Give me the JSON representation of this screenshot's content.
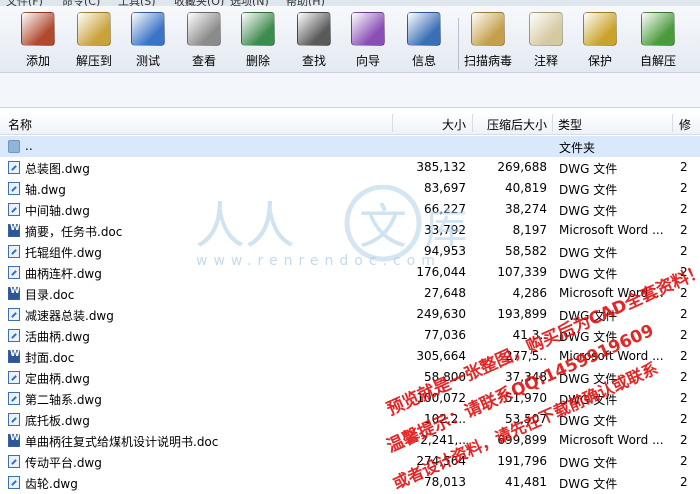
{
  "menu": [
    "文件(F)",
    "命令(C)",
    "工具(S)",
    "收藏夹(O)",
    "选项(N)",
    "帮助(H)"
  ],
  "toolbar": [
    {
      "label": "添加",
      "icon": "add-archive-icon",
      "color": "#b04a2e"
    },
    {
      "label": "解压到",
      "icon": "extract-to-icon",
      "color": "#c9a23a"
    },
    {
      "label": "测试",
      "icon": "test-icon",
      "color": "#3b74c7"
    },
    {
      "label": "查看",
      "icon": "view-icon",
      "color": "#8b8b8b"
    },
    {
      "label": "删除",
      "icon": "delete-icon",
      "color": "#3f8b4f"
    },
    {
      "label": "查找",
      "icon": "find-icon",
      "color": "#5a5a5a"
    },
    {
      "label": "向导",
      "icon": "wizard-icon",
      "color": "#8a4fb5"
    },
    {
      "label": "信息",
      "icon": "info-icon",
      "color": "#3a6fb5"
    },
    {
      "label": "扫描病毒",
      "icon": "scan-virus-icon",
      "color": "#c4a04a"
    },
    {
      "label": "注释",
      "icon": "comment-icon",
      "color": "#d4c9a0"
    },
    {
      "label": "保护",
      "icon": "protect-icon",
      "color": "#c8a42a"
    },
    {
      "label": "自解压",
      "icon": "sfx-icon",
      "color": "#4b9b3c"
    }
  ],
  "columns": {
    "name": "名称",
    "size": "大小",
    "packed": "压缩后大小",
    "type": "类型",
    "extra": "修"
  },
  "files": [
    {
      "name": "..",
      "size": "",
      "packed": "",
      "type": "文件夹",
      "extra": "",
      "icon": "folder",
      "selected": true
    },
    {
      "name": "总装图.dwg",
      "size": "385,132",
      "packed": "269,688",
      "type": "DWG 文件",
      "extra": "2",
      "icon": "dwg"
    },
    {
      "name": "轴.dwg",
      "size": "83,697",
      "packed": "40,819",
      "type": "DWG 文件",
      "extra": "2",
      "icon": "dwg"
    },
    {
      "name": "中间轴.dwg",
      "size": "66,227",
      "packed": "38,274",
      "type": "DWG 文件",
      "extra": "2",
      "icon": "dwg"
    },
    {
      "name": "摘要，任务书.doc",
      "size": "33,792",
      "packed": "8,197",
      "type": "Microsoft Word ...",
      "extra": "2",
      "icon": "doc"
    },
    {
      "name": "托辊组件.dwg",
      "size": "94,953",
      "packed": "58,582",
      "type": "DWG 文件",
      "extra": "2",
      "icon": "dwg"
    },
    {
      "name": "曲柄连杆.dwg",
      "size": "176,044",
      "packed": "107,339",
      "type": "DWG 文件",
      "extra": "2",
      "icon": "dwg"
    },
    {
      "name": "目录.doc",
      "size": "27,648",
      "packed": "4,286",
      "type": "Microsoft Word ...",
      "extra": "2",
      "icon": "doc"
    },
    {
      "name": "减速器总装.dwg",
      "size": "249,630",
      "packed": "193,899",
      "type": "DWG 文件",
      "extra": "2",
      "icon": "dwg"
    },
    {
      "name": "活曲柄.dwg",
      "size": "77,036",
      "packed": "41,3..",
      "type": "DWG 文件",
      "extra": "2",
      "icon": "dwg"
    },
    {
      "name": "封面.doc",
      "size": "305,664",
      "packed": "277,5..",
      "type": "Microsoft Word ...",
      "extra": "2",
      "icon": "doc"
    },
    {
      "name": "定曲柄.dwg",
      "size": "58,800",
      "packed": "37,348",
      "type": "DWG 文件",
      "extra": "2",
      "icon": "dwg"
    },
    {
      "name": "第二轴系.dwg",
      "size": "100,072",
      "packed": "51,970",
      "type": "DWG 文件",
      "extra": "2",
      "icon": "dwg"
    },
    {
      "name": "底托板.dwg",
      "size": "102,2..",
      "packed": "53,507",
      "type": "DWG 文件",
      "extra": "2",
      "icon": "dwg"
    },
    {
      "name": "单曲柄往复式给煤机设计说明书.doc",
      "size": "2,241,..",
      "packed": "699,899",
      "type": "Microsoft Word ...",
      "extra": "2",
      "icon": "doc"
    },
    {
      "name": "传动平台.dwg",
      "size": "274,564",
      "packed": "191,796",
      "type": "DWG 文件",
      "extra": "2",
      "icon": "dwg"
    },
    {
      "name": "齿轮.dwg",
      "size": "78,013",
      "packed": "41,481",
      "type": "DWG 文件",
      "extra": "2",
      "icon": "dwg"
    }
  ],
  "watermark": {
    "logo_left": "人人",
    "logo_char": "文",
    "logo_right": "库",
    "site": "www.renrendoc.com",
    "line1": "预览就是一张整图，购买后为CAD全套资料！",
    "line2": "温馨提示：请联系QQ:1459919609",
    "line3": "或者设计资料，请先在下载前确认或联系"
  }
}
